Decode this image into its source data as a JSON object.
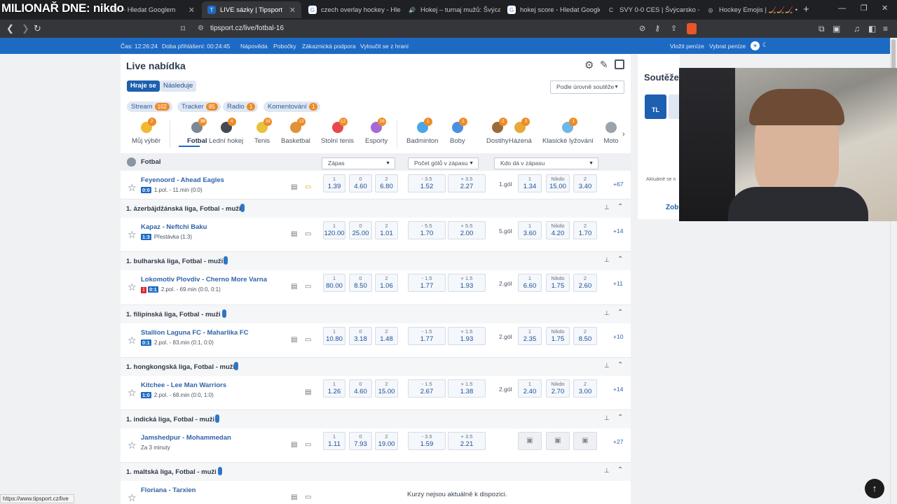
{
  "overlay_title": "MILIONAŘ DNE: nikdo",
  "browser": {
    "tabs": [
      {
        "title": "- Hledat Googlem",
        "icon": "😏",
        "active": false
      },
      {
        "title": "LIVE sázky | Tipsport",
        "icon": "T",
        "active": true
      },
      {
        "title": "czech overlay hockey - Hledat",
        "icon": "G",
        "active": false
      },
      {
        "title": "Hokej – turnaj mužů: Švýca",
        "icon": "🔊",
        "active": false
      },
      {
        "title": "hokej score - Hledat Googlem",
        "icon": "G",
        "active": false
      },
      {
        "title": "SVY 0-0 CES | Švýcarsko - Česk",
        "icon": "C",
        "active": false
      },
      {
        "title": "Hockey Emojis | 🏒🏒🏒 • ° •",
        "icon": "◎",
        "active": false
      }
    ],
    "new_tab": "+",
    "url": "tipsport.cz/live/fotbal-16"
  },
  "site_bar": {
    "time": "Čas: 12:26:24",
    "login_time": "Doba přihlášení: 00:24:45",
    "links": [
      "Nápověda",
      "Pobočky",
      "Zákaznická podpora",
      "Vyloučit se z hraní"
    ],
    "deposit": "Vložit peníze",
    "withdraw": "Vybrat peníze"
  },
  "panel": {
    "title": "Live nabídka",
    "tab_playing": "Hraje se",
    "tab_next": "Následuje",
    "sort_select": "Podle úrovně soutěže",
    "chips": [
      {
        "label": "Stream",
        "count": "102"
      },
      {
        "label": "Tracker",
        "count": "85"
      },
      {
        "label": "Radio",
        "count": "1"
      },
      {
        "label": "Komentování",
        "count": "1"
      }
    ],
    "sports": [
      {
        "label": "Můj výběr",
        "count": "2",
        "color": "#f2b830"
      },
      {
        "label": "Fotbal",
        "count": "39",
        "color": "#7c8796"
      },
      {
        "label": "Lední hokej",
        "count": "4",
        "color": "#444a52"
      },
      {
        "label": "Tenis",
        "count": "39",
        "color": "#e9c23b"
      },
      {
        "label": "Basketbal",
        "count": "13",
        "color": "#e0913a"
      },
      {
        "label": "Stolní tenis",
        "count": "12",
        "color": "#e5484d"
      },
      {
        "label": "Esporty",
        "count": "26",
        "color": "#a56ad6"
      },
      {
        "label": "Badminton",
        "count": "1",
        "color": "#4aa6e8"
      },
      {
        "label": "Boby",
        "count": "1",
        "color": "#4a8fe0"
      },
      {
        "label": "Dostihy",
        "count": "2",
        "color": "#9b6b3c"
      },
      {
        "label": "Házená",
        "count": "3",
        "color": "#e8a93a"
      },
      {
        "label": "Klasické lyžování",
        "count": "1",
        "color": "#6fb6e8"
      },
      {
        "label": "Moto",
        "count": "",
        "color": "#9aa3ad"
      }
    ],
    "section": "Fotbal",
    "columns": [
      "Zápas",
      "Počet gólů v zápasu",
      "Kdo dá v zápasu"
    ]
  },
  "leagues": [
    {
      "name": "",
      "matches": [
        {
          "teams": "Feyenoord - Ahead Eagles",
          "score": "0:0",
          "red": "",
          "status": "1.pol. - 11.min (0:0)",
          "o1": "1.39",
          "o0": "4.60",
          "o2": "6.80",
          "line_minus": "- 3.5",
          "line_plus": "+ 3.5",
          "under": "1.52",
          "over": "2.27",
          "goal": "1.gól",
          "g1": "1.34",
          "gn": "15.00",
          "g2": "3.40",
          "more": "+67"
        }
      ]
    },
    {
      "name": "1. ázerbájdžánská liga, Fotbal - muži",
      "matches": [
        {
          "teams": "Kapaz - Neftchi Baku",
          "score": "1:3",
          "red": "",
          "status": "Přestávka (1:3)",
          "o1": "120.00",
          "o0": "25.00",
          "o2": "1.01",
          "line_minus": "- 5.5",
          "line_plus": "+ 5.5",
          "under": "1.70",
          "over": "2.00",
          "goal": "5.gól",
          "g1": "3.60",
          "gn": "4.20",
          "g2": "1.70",
          "more": "+14"
        }
      ]
    },
    {
      "name": "1. bulharská liga, Fotbal - muži",
      "matches": [
        {
          "teams": "Lokomotiv Plovdiv - Cherno More Varna",
          "score": "0:1",
          "red": "1",
          "status": "2.pol. - 69.min (0:0, 0:1)",
          "o1": "80.00",
          "o0": "8.50",
          "o2": "1.06",
          "line_minus": "- 1.5",
          "line_plus": "+ 1.5",
          "under": "1.77",
          "over": "1.93",
          "goal": "2.gól",
          "g1": "6.60",
          "gn": "1.75",
          "g2": "2.60",
          "more": "+11"
        }
      ]
    },
    {
      "name": "1. filipínská liga, Fotbal - muži",
      "matches": [
        {
          "teams": "Stallion Laguna FC - Maharlika FC",
          "score": "0:1",
          "red": "",
          "status": "2.pol. - 83.min (0:1, 0:0)",
          "o1": "10.80",
          "o0": "3.18",
          "o2": "1.48",
          "line_minus": "- 1.5",
          "line_plus": "+ 1.5",
          "under": "1.77",
          "over": "1.93",
          "goal": "2.gól",
          "g1": "2.35",
          "gn": "1.75",
          "g2": "8.50",
          "more": "+10"
        }
      ]
    },
    {
      "name": "1. hongkongská liga, Fotbal - muži",
      "matches": [
        {
          "teams": "Kitchee - Lee Man Warriors",
          "score": "1:0",
          "red": "",
          "status": "2.pol. - 68.min (0:0, 1:0)",
          "o1": "1.26",
          "o0": "4.60",
          "o2": "15.00",
          "line_minus": "- 1.5",
          "line_plus": "+ 1.5",
          "under": "2.67",
          "over": "1.38",
          "goal": "2.gól",
          "g1": "2.40",
          "gn": "2.70",
          "g2": "3.00",
          "more": "+14"
        }
      ]
    },
    {
      "name": "1. indická liga, Fotbal - muži",
      "matches": [
        {
          "teams": "Jamshedpur - Mohammedan",
          "score": "",
          "red": "",
          "status": "Za 3 minuty",
          "o1": "1.11",
          "o0": "7.93",
          "o2": "19.00",
          "line_minus": "- 3.5",
          "line_plus": "+ 3.5",
          "under": "1.59",
          "over": "2.21",
          "goal": "",
          "g1": "",
          "gn": "",
          "g2": "",
          "more": "+27",
          "locked": true
        }
      ]
    },
    {
      "name": "1. maltská liga, Fotbal - muži",
      "matches": [
        {
          "teams": "Floriana - Tarxien",
          "score": "",
          "red": "",
          "status": "",
          "unavailable": "Kurzy nejsou aktuálně k dispozici."
        }
      ]
    }
  ],
  "odds_labels": {
    "home": "1",
    "draw": "0",
    "away": "2",
    "nobody": "Nikdo"
  },
  "right": {
    "title": "Soutěže",
    "badge": "TL",
    "text": "Aktuálně se n",
    "link": "Zob"
  },
  "status_url": "https://www.tipsport.cz/live"
}
